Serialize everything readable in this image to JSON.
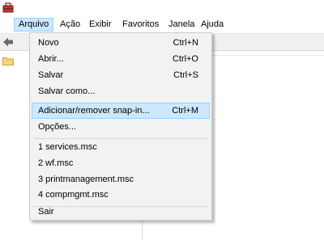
{
  "menubar": {
    "items": [
      "Arquivo",
      "Ação",
      "Exibir",
      "Favoritos",
      "Janela",
      "Ajuda"
    ]
  },
  "file_menu": {
    "group1": [
      {
        "label": "Novo",
        "shortcut": "Ctrl+N"
      },
      {
        "label": "Abrir...",
        "shortcut": "Ctrl+O"
      },
      {
        "label": "Salvar",
        "shortcut": "Ctrl+S"
      },
      {
        "label": "Salvar como...",
        "shortcut": ""
      }
    ],
    "group2": [
      {
        "label": "Adicionar/remover snap-in...",
        "shortcut": "Ctrl+M"
      },
      {
        "label": "Opções...",
        "shortcut": ""
      }
    ],
    "recent": [
      {
        "label": "1 services.msc"
      },
      {
        "label": "2 wf.msc"
      },
      {
        "label": "3 printmanagement.msc"
      },
      {
        "label": "4 compmgmt.msc"
      }
    ],
    "exit": {
      "label": "Sair"
    }
  },
  "icons": {
    "app": "mmc-toolbox-icon",
    "back": "back-arrow-icon",
    "tree": "folder-icon"
  },
  "colors": {
    "highlight": "#cce8ff",
    "highlight_border": "#99d1ff",
    "menu_bg": "#f2f2f2"
  }
}
